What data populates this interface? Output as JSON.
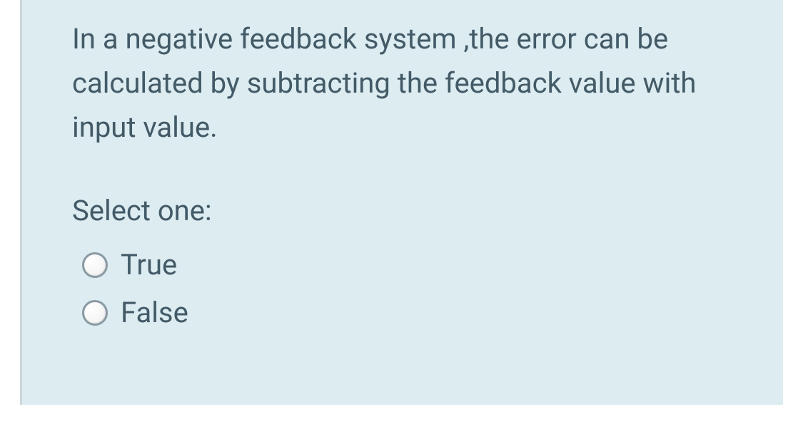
{
  "question": {
    "text": "In a negative feedback system ,the error can be calculated by subtracting  the feedback value with input value.",
    "prompt": "Select one:",
    "options": [
      {
        "label": "True"
      },
      {
        "label": "False"
      }
    ]
  }
}
